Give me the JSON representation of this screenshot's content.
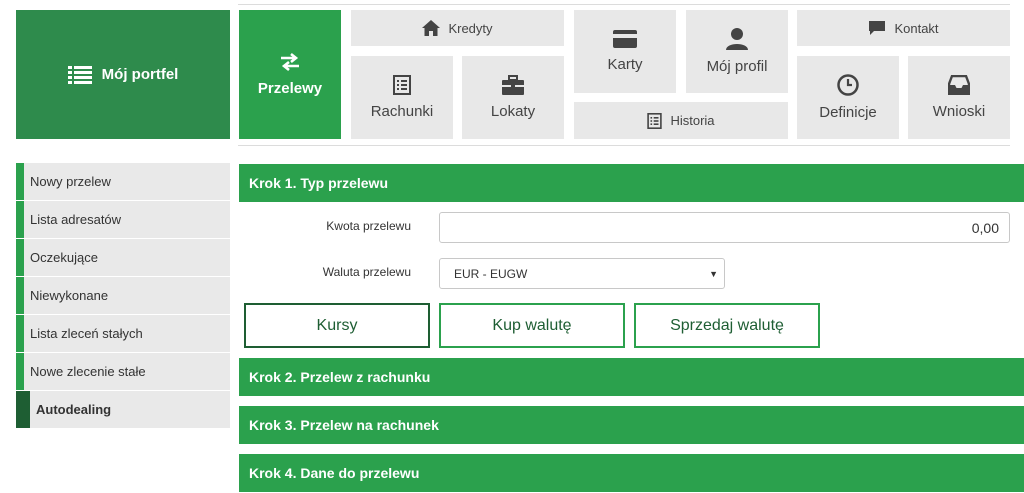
{
  "nav": {
    "portfel": "Mój portfel",
    "przelewy": "Przelewy",
    "kredyty": "Kredyty",
    "rachunki": "Rachunki",
    "lokaty": "Lokaty",
    "karty": "Karty",
    "profil": "Mój profil",
    "historia": "Historia",
    "kontakt": "Kontakt",
    "definicje": "Definicje",
    "wnioski": "Wnioski"
  },
  "sidebar": {
    "items": [
      {
        "label": "Nowy przelew"
      },
      {
        "label": "Lista adresatów"
      },
      {
        "label": "Oczekujące"
      },
      {
        "label": "Niewykonane"
      },
      {
        "label": "Lista zleceń stałych"
      },
      {
        "label": "Nowe zlecenie stałe"
      },
      {
        "label": "Autodealing"
      }
    ]
  },
  "steps": {
    "step1": "Krok 1. Typ przelewu",
    "step2": "Krok 2. Przelew z rachunku",
    "step3": "Krok 3. Przelew na rachunek",
    "step4": "Krok 4. Dane do przelewu"
  },
  "form": {
    "amount_label": "Kwota przelewu",
    "amount_value": "0,00",
    "currency_label": "Waluta przelewu",
    "currency_value": "EUR - EUGW"
  },
  "buttons": {
    "kursy": "Kursy",
    "kup": "Kup walutę",
    "sprzedaj": "Sprzedaj walutę"
  },
  "colors": {
    "primary_green": "#2ba14d",
    "dark_green": "#1e5e33",
    "tile_gray": "#e8e8e8"
  }
}
